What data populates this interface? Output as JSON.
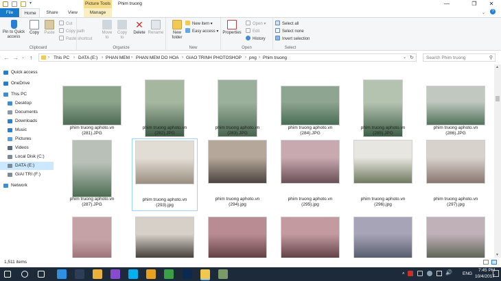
{
  "window": {
    "context_tab": "Picture Tools",
    "title": "Phim truong",
    "buttons": {
      "minimize": "—",
      "maximize": "❐",
      "close": "✕"
    }
  },
  "tabs": [
    "File",
    "Home",
    "Share",
    "View",
    "Manage"
  ],
  "ribbon": {
    "clipboard": {
      "pin": "Pin to Quick access",
      "copy": "Copy",
      "paste": "Paste",
      "cut": "Cut",
      "copy_path": "Copy path",
      "paste_shortcut": "Paste shortcut",
      "label": "Clipboard"
    },
    "organize": {
      "move_to": "Move to",
      "copy_to": "Copy to",
      "delete": "Delete",
      "rename": "Rename",
      "label": "Organize"
    },
    "new": {
      "new_folder": "New folder",
      "new_item": "New item ▾",
      "easy_access": "Easy access ▾",
      "label": "New"
    },
    "open": {
      "properties": "Properties",
      "open": "Open ▾",
      "edit": "Edit",
      "history": "History",
      "label": "Open"
    },
    "select": {
      "select_all": "Select all",
      "select_none": "Select none",
      "invert": "Invert selection",
      "label": "Select"
    }
  },
  "address": {
    "crumbs": [
      "This PC",
      "DATA (E:)",
      "PHAN MEM",
      "PHAN MEM DO HOA",
      "GIAO TRINH PHOTOSHOP",
      "png",
      "Phim truong"
    ],
    "search_placeholder": "Search Phim truong"
  },
  "nav": [
    {
      "label": "Quick access",
      "icon": "star-icon",
      "color": "#1e7fd4"
    },
    {
      "label": "OneDrive",
      "icon": "cloud-icon",
      "color": "#1e7fd4"
    },
    {
      "label": "This PC",
      "icon": "computer-icon",
      "color": "#3a8fd8"
    },
    {
      "label": "Desktop",
      "icon": "desktop-icon",
      "color": "#3a8fd8"
    },
    {
      "label": "Documents",
      "icon": "documents-icon",
      "color": "#8a9aa8"
    },
    {
      "label": "Downloads",
      "icon": "download-icon",
      "color": "#2a7fcf"
    },
    {
      "label": "Music",
      "icon": "music-icon",
      "color": "#2a7fcf"
    },
    {
      "label": "Pictures",
      "icon": "pictures-icon",
      "color": "#5a9fd8"
    },
    {
      "label": "Videos",
      "icon": "videos-icon",
      "color": "#5a6a7a"
    },
    {
      "label": "Local Disk (C:)",
      "icon": "drive-icon",
      "color": "#7a8a98"
    },
    {
      "label": "DATA (E:)",
      "icon": "drive-icon",
      "color": "#7a8a98"
    },
    {
      "label": "GIAI TRI (F:)",
      "icon": "drive-icon",
      "color": "#7a8a98"
    },
    {
      "label": "Network",
      "icon": "network-icon",
      "color": "#3a8fd8"
    }
  ],
  "files": [
    {
      "name": "phim truong aphoto.vn (281).JPG",
      "c1": "#8aa58a",
      "c2": "#4f6a55"
    },
    {
      "name": "phim truong aphoto.vn (282).JPG",
      "c1": "#a6b7a0",
      "c2": "#3d5a45"
    },
    {
      "name": "phim truong aphoto.vn (283).JPG",
      "c1": "#9bb09a",
      "c2": "#4a6550"
    },
    {
      "name": "phim truong aphoto.vn (284).JPG",
      "c1": "#8ea691",
      "c2": "#4a6d55"
    },
    {
      "name": "phim truong aphoto.vn (285).JPG",
      "c1": "#b4c2b0",
      "c2": "#3c5f46"
    },
    {
      "name": "phim truong aphoto.vn (286).JPG",
      "c1": "#c0c8c0",
      "c2": "#52735a"
    },
    {
      "name": "phim truong aphoto.vn (287).JPG",
      "c1": "#b8c0b8",
      "c2": "#4d6e52"
    },
    {
      "name": "phim truong aphoto.vn (293).jpg",
      "c1": "#e2ddd4",
      "c2": "#9a8e80"
    },
    {
      "name": "phim truong aphoto.vn (294).jpg",
      "c1": "#b5a89a",
      "c2": "#4c4440"
    },
    {
      "name": "phim truong aphoto.vn (295).jpg",
      "c1": "#c9a9b0",
      "c2": "#6a5058"
    },
    {
      "name": "phim truong aphoto.vn (296).jpg",
      "c1": "#e8e6e0",
      "c2": "#6f7a60"
    },
    {
      "name": "phim truong aphoto.vn (297).jpg",
      "c1": "#d8d2cc",
      "c2": "#8a7670"
    },
    {
      "name": "",
      "c1": "#c4a2a6",
      "c2": "#7a4c52"
    },
    {
      "name": "",
      "c1": "#d6d0c8",
      "c2": "#3a3430"
    },
    {
      "name": "",
      "c1": "#b88c92",
      "c2": "#5c3a3e"
    },
    {
      "name": "",
      "c1": "#c29aa0",
      "c2": "#5a3a40"
    },
    {
      "name": "",
      "c1": "#a8a4b8",
      "c2": "#505868"
    },
    {
      "name": "",
      "c1": "#c0b0b8",
      "c2": "#56604e"
    }
  ],
  "status": {
    "item_count": "1,511 items"
  },
  "taskbar": {
    "apps": [
      {
        "icon": "windows-start-icon",
        "color": "#ffffff"
      },
      {
        "icon": "search-icon",
        "color": "#ffffff"
      },
      {
        "icon": "task-view-icon",
        "color": "#ffffff"
      },
      {
        "icon": "edge-icon",
        "color": "#2f8fe0"
      },
      {
        "icon": "lightroom-icon",
        "color": "#2c3e5a"
      },
      {
        "icon": "app-multicolor-icon",
        "color": "#e8b23a"
      },
      {
        "icon": "app-purple-icon",
        "color": "#8a4ad0"
      },
      {
        "icon": "skype-icon",
        "color": "#00aff0"
      },
      {
        "icon": "chrome-icon",
        "color": "#e8a020"
      },
      {
        "icon": "camtasia-icon",
        "color": "#3aa046"
      },
      {
        "icon": "photoshop-icon",
        "color": "#0a2a50"
      },
      {
        "icon": "file-explorer-icon",
        "color": "#f0c850"
      },
      {
        "icon": "app-green-icon",
        "color": "#7a9a6a"
      }
    ],
    "language": "ENG",
    "time": "7:45 PM",
    "date": "10/4/2017"
  }
}
